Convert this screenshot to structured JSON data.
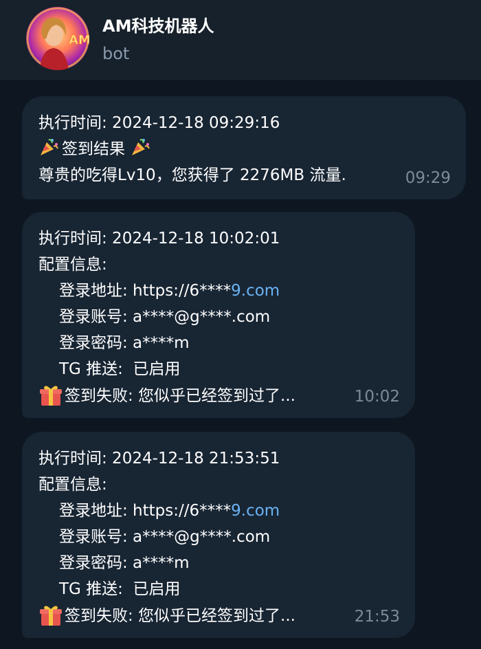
{
  "header": {
    "title": "AM科技机器人",
    "subtitle": "bot",
    "avatar_label": "AM"
  },
  "messages": [
    {
      "lines": [
        "执行时间: 2024-12-18 09:29:16",
        "签到结果",
        "尊贵的吃得Lv10，您获得了 2276MB 流量."
      ],
      "time": "09:29"
    },
    {
      "exec": "执行时间: 2024-12-18 10:02:01",
      "config_title": "配置信息:",
      "login_url_prefix": "登录地址: https://6****",
      "login_url_link": "9.com",
      "account": "登录账号: a****@g****.com",
      "password": "登录密码: a****m",
      "tg": "TG 推送:  已启用",
      "result": "签到失败: 您似乎已经签到过了...",
      "time": "10:02"
    },
    {
      "exec": "执行时间: 2024-12-18 21:53:51",
      "config_title": "配置信息:",
      "login_url_prefix": "登录地址: https://6****",
      "login_url_link": "9.com",
      "account": "登录账号: a****@g****.com",
      "password": "登录密码: a****m",
      "tg": "TG 推送:  已启用",
      "result": "签到失败: 您似乎已经签到过了...",
      "time": "21:53"
    }
  ],
  "colors": {
    "background": "#0e1621",
    "header": "#17212b",
    "bubble": "#182533",
    "link": "#6ab3f3",
    "time": "#7d8b99",
    "subtitle": "#8a9aad"
  },
  "icons": {
    "party": "party-popper-icon",
    "gift": "gift-icon"
  }
}
